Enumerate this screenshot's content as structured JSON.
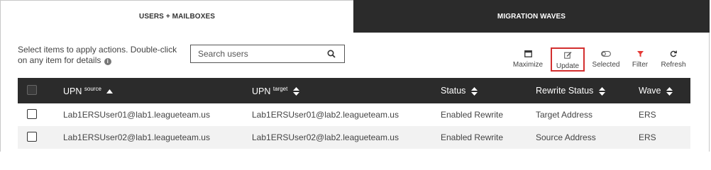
{
  "tabs": [
    {
      "label": "USERS + MAILBOXES",
      "active": true
    },
    {
      "label": "MIGRATION WAVES",
      "active": false
    }
  ],
  "hint": "Select items to apply actions. Double-click on any item for details",
  "search": {
    "placeholder": "Search users",
    "value": ""
  },
  "toolbar": {
    "maximize": "Maximize",
    "update": "Update",
    "selected": "Selected",
    "filter": "Filter",
    "refresh": "Refresh"
  },
  "table": {
    "headers": {
      "upn_source": "UPN",
      "upn_source_sup": "source",
      "upn_target": "UPN",
      "upn_target_sup": "target",
      "status": "Status",
      "rewrite_status": "Rewrite Status",
      "wave": "Wave"
    },
    "rows": [
      {
        "upn_source": "Lab1ERSUser01@lab1.leagueteam.us",
        "upn_target": "Lab1ERSUser01@lab2.leagueteam.us",
        "status": "Enabled Rewrite",
        "rewrite_status": "Target Address",
        "wave": "ERS"
      },
      {
        "upn_source": "Lab1ERSUser02@lab1.leagueteam.us",
        "upn_target": "Lab1ERSUser02@lab2.leagueteam.us",
        "status": "Enabled Rewrite",
        "rewrite_status": "Source Address",
        "wave": "ERS"
      }
    ]
  },
  "colors": {
    "header_bg": "#2b2b2b",
    "highlight": "#d32f2f",
    "filter_icon": "#e53935"
  }
}
